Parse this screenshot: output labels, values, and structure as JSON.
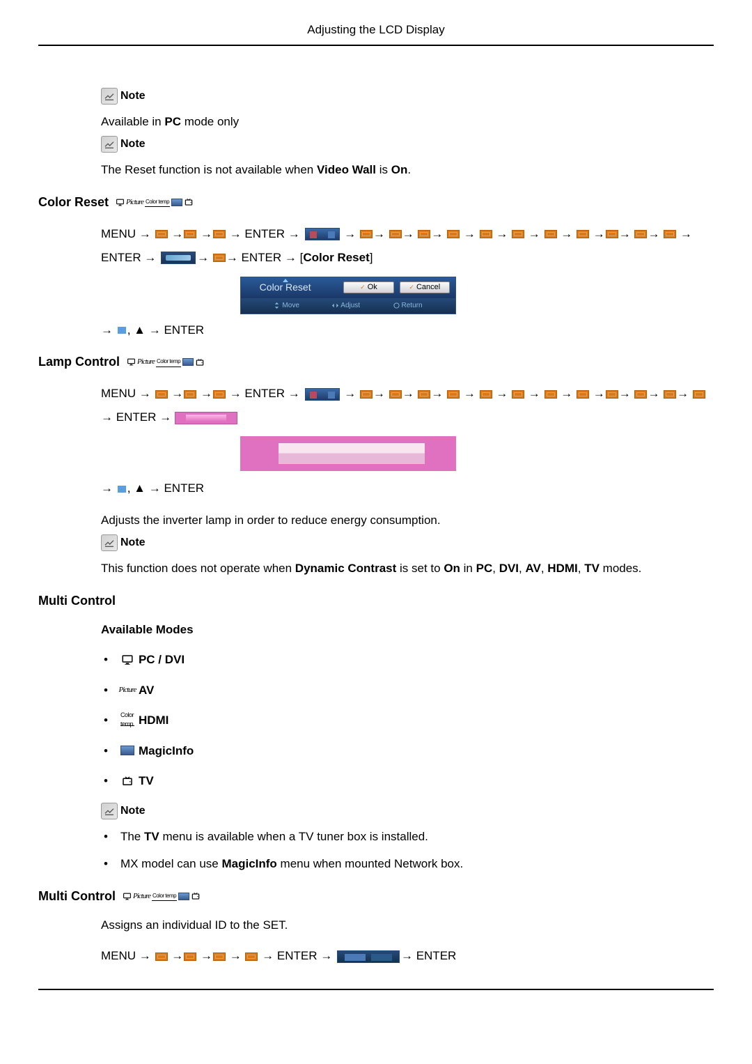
{
  "header": {
    "title": "Adjusting the LCD Display"
  },
  "section1": {
    "note_label": "Note",
    "line1_pre": "Available in ",
    "line1_bold": "PC",
    "line1_post": " mode only",
    "note2_label": "Note",
    "line2_pre": "The Reset function is not available when ",
    "line2_bold": "Video Wall",
    "line2_mid": " is ",
    "line2_bold2": "On",
    "line2_post": "."
  },
  "color_reset": {
    "title": "Color Reset",
    "path_start": "MENU → ",
    "enter": "ENTER",
    "color_reset_label": "Color Reset",
    "dialog": {
      "label": "Color Reset",
      "ok": "Ok",
      "cancel": "Cancel",
      "move": "Move",
      "adjust": "Adjust",
      "return": "Return"
    },
    "final_nav": ", ▲ → ENTER"
  },
  "lamp_control": {
    "title": "Lamp Control",
    "path_start": "MENU → ",
    "enter": "ENTER",
    "final_nav": ", ▲ → ENTER",
    "desc": "Adjusts the inverter lamp in order to reduce energy consumption.",
    "note_label": "Note",
    "note_pre": "This function does not operate when ",
    "note_bold1": "Dynamic Contrast",
    "note_mid1": " is set to ",
    "note_bold2": "On",
    "note_mid2": " in ",
    "note_bold3": "PC",
    "note_sep1": ", ",
    "note_bold4": "DVI",
    "note_sep2": ", ",
    "note_bold5": "AV",
    "note_sep3": ", ",
    "note_bold6": "HDMI",
    "note_sep4": ", ",
    "note_bold7": "TV",
    "note_post": " modes."
  },
  "multi_control": {
    "title": "Multi Control",
    "available_modes_title": "Available Modes",
    "modes": {
      "pc": "PC / DVI",
      "av": "AV",
      "hdmi": "HDMI",
      "magicinfo": "MagicInfo",
      "tv": "TV"
    },
    "note_label": "Note",
    "note_items": {
      "item1_pre": "The ",
      "item1_bold": "TV",
      "item1_post": " menu is available when a TV tuner box is installed.",
      "item2_pre": "MX model can use ",
      "item2_bold": "MagicInfo",
      "item2_post": " menu when mounted Network box."
    }
  },
  "multi_control2": {
    "title": "Multi Control",
    "desc": "Assigns an individual ID to the SET.",
    "path_start": "MENU → ",
    "enter": "ENTER"
  }
}
